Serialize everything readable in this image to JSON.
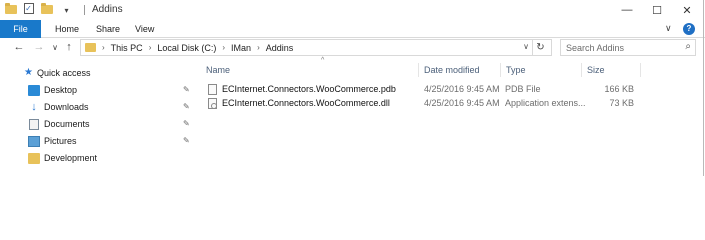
{
  "window": {
    "title": "Addins",
    "controls": {
      "minimize": "—",
      "maximize": "☐",
      "close": "✕"
    }
  },
  "ribbon": {
    "tabs": [
      "File",
      "Home",
      "Share",
      "View"
    ],
    "collapse_glyph": "∨",
    "help_glyph": "?"
  },
  "nav": {
    "back_glyph": "←",
    "forward_glyph": "→",
    "recent_glyph": "∨",
    "up_glyph": "↑",
    "breadcrumb": [
      "This PC",
      "Local Disk (C:)",
      "IMan",
      "Addins"
    ],
    "refresh_glyph": "↻"
  },
  "search": {
    "placeholder": "Search Addins",
    "icon_glyph": "⌕"
  },
  "navpane": {
    "quick_access": "Quick access",
    "items": [
      {
        "label": "Desktop",
        "icon": "desktop-icon",
        "pinned": true
      },
      {
        "label": "Downloads",
        "icon": "downloads-icon",
        "pinned": true
      },
      {
        "label": "Documents",
        "icon": "documents-icon",
        "pinned": true
      },
      {
        "label": "Pictures",
        "icon": "pictures-icon",
        "pinned": true
      },
      {
        "label": "Development",
        "icon": "folder-icon",
        "pinned": false
      }
    ],
    "pin_glyph": "📌"
  },
  "filelist": {
    "columns": {
      "name": "Name",
      "date": "Date modified",
      "type": "Type",
      "size": "Size"
    },
    "sort_glyph": "^",
    "files": [
      {
        "name": "ECInternet.Connectors.WooCommerce.pdb",
        "date": "4/25/2016 9:45 AM",
        "type": "PDB File",
        "size": "166 KB"
      },
      {
        "name": "ECInternet.Connectors.WooCommerce.dll",
        "date": "4/25/2016 9:45 AM",
        "type": "Application extens...",
        "size": "73 KB"
      }
    ]
  },
  "colors": {
    "file_tab": "#1979ca",
    "folder": "#e8c25a",
    "accent": "#2a78d2"
  }
}
